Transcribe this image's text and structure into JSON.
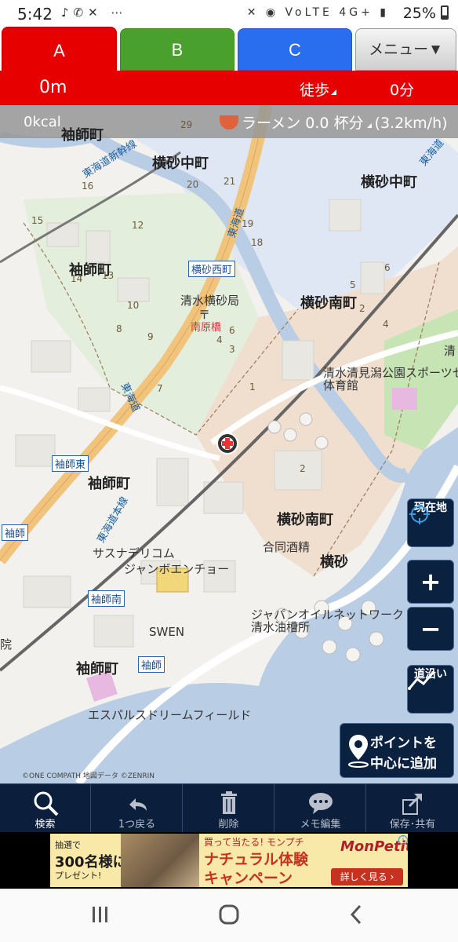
{
  "status": {
    "time": "5:42",
    "battery": "25%",
    "network": "4G+",
    "volte": "VoLTE"
  },
  "tabs": [
    {
      "label": "A",
      "color": "#e60000"
    },
    {
      "label": "B",
      "color": "#4aa02c"
    },
    {
      "label": "C",
      "color": "#2a6ef0"
    }
  ],
  "menu_label": "メニュー▼",
  "info": {
    "distance": "0m",
    "mode": "徒歩",
    "minutes": "0分"
  },
  "calorie": {
    "kcal": "0kcal",
    "ramen": "ラーメン 0.0 杯分",
    "speed": "(3.2km/h)"
  },
  "map": {
    "areas": {
      "sodeshi1": "袖師町",
      "yokosuna_naka1": "横砂中町",
      "yokosuna_naka2": "横砂中町",
      "sodeshi2": "袖師町",
      "yokosuna_minami1": "横砂南町",
      "sodeshi3": "袖師町",
      "yokosuna_minami2": "横砂南町",
      "yokosuna": "横砂",
      "sodeshi4": "袖師町"
    },
    "pois": {
      "post": "清水横砂局",
      "nanbara": "南原橋",
      "park": "清水清見潟公園スポーツセン",
      "gym": "体育館",
      "sasuna": "サスナデリコム",
      "jambo": "ジャンボエンチョー",
      "godo": "合同酒精",
      "japan_oil": "ジャパンオイルネットワーク",
      "oil_plant": "清水油槽所",
      "swen": "SWEN",
      "espulse": "エスパルスドリームフィールド",
      "in": "院",
      "kiyo": "清"
    },
    "stations": {
      "yokosuna_nishi": "横砂西町",
      "sodeshi_higashi": "袖師東",
      "sodeshi_minami": "袖師南",
      "sodeshi": "袖師",
      "sode_left": "袖師"
    },
    "roads": {
      "tokaido_shinkansen": "東海道新幹線",
      "tokaido": "東海道",
      "tokaido_honsen": "東海道本線",
      "tokaido2": "東海道",
      "tokaido3": "東海道"
    },
    "numbers": [
      "29",
      "20",
      "21",
      "16",
      "15",
      "12",
      "19",
      "18",
      "14",
      "13",
      "10",
      "8",
      "9",
      "7",
      "6",
      "4",
      "3",
      "1",
      "2",
      "5",
      "2",
      "4",
      "6"
    ],
    "copyright": "©ONE COMPATH 地図データ ©ZENRIN"
  },
  "buttons": {
    "current_location": "現在地",
    "zoom_in": "+",
    "zoom_out": "−",
    "along_road": "道沿い",
    "add_point_line1": "ポイントを",
    "add_point_line2": "中心に追加"
  },
  "toolbar": [
    {
      "label": "検索",
      "icon": "search-icon"
    },
    {
      "label": "1つ戻る",
      "icon": "back-icon"
    },
    {
      "label": "削除",
      "icon": "trash-icon"
    },
    {
      "label": "メモ編集",
      "icon": "memo-icon"
    },
    {
      "label": "保存･共有",
      "icon": "share-icon"
    }
  ],
  "ad": {
    "lottery": "抽選で",
    "count": "300名様に",
    "present": "プレゼント!",
    "headline": "買って当たる! モンプチ",
    "line2": "ナチュラル体験",
    "line3": "キャンペーン",
    "logo": "MonPetit",
    "more": "詳しく見る ›",
    "info": "i"
  }
}
